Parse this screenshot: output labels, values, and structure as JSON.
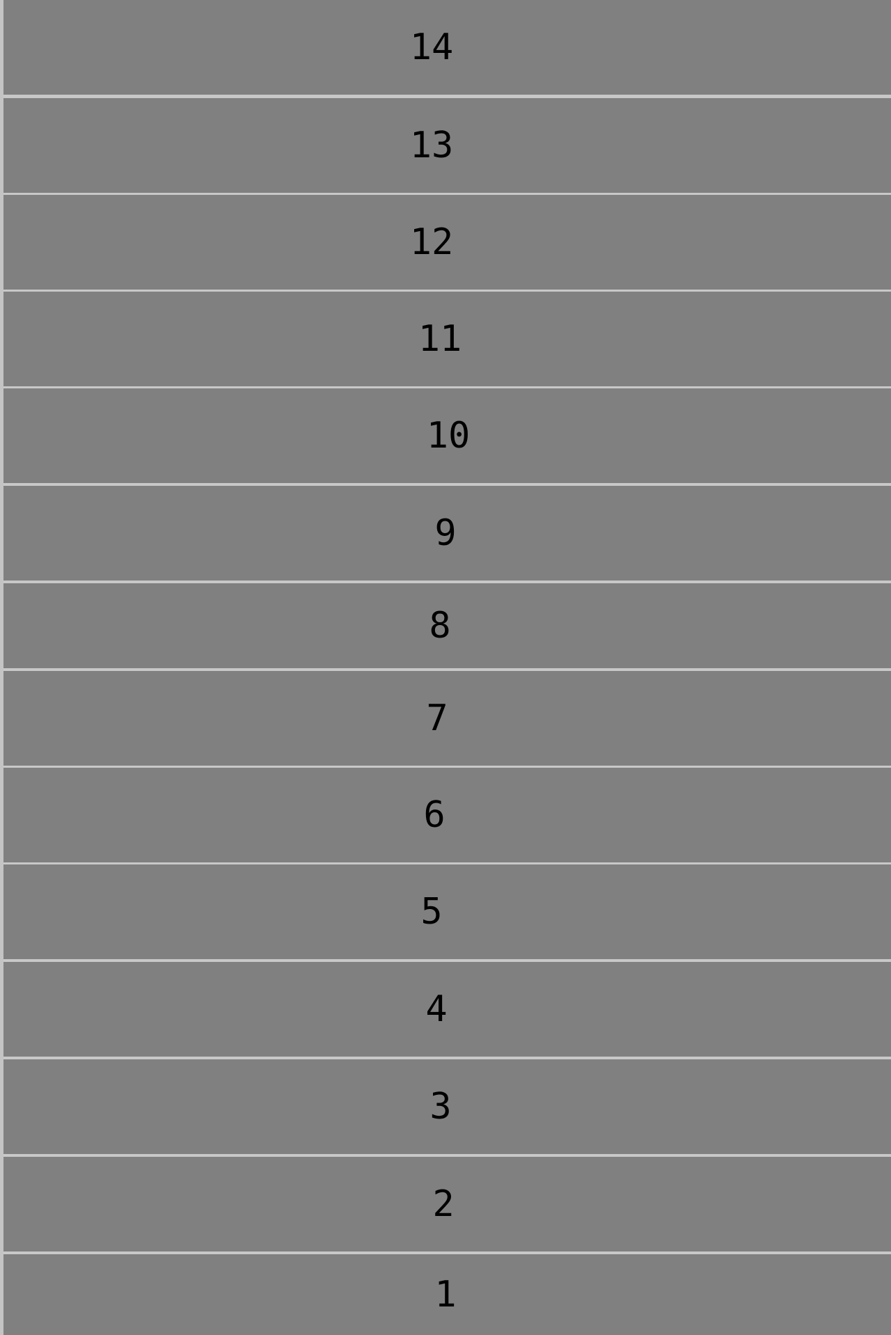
{
  "background_color": "#808080",
  "separator_color": "#c8c8c8",
  "text_color": "#000000",
  "rows": [
    {
      "label": "14"
    },
    {
      "label": "13"
    },
    {
      "label": "12"
    },
    {
      "label": "11"
    },
    {
      "label": "10"
    },
    {
      "label": "9"
    },
    {
      "label": "8"
    },
    {
      "label": "7"
    },
    {
      "label": "6"
    },
    {
      "label": "5"
    },
    {
      "label": "4"
    },
    {
      "label": "3"
    },
    {
      "label": "2"
    },
    {
      "label": "1"
    }
  ]
}
